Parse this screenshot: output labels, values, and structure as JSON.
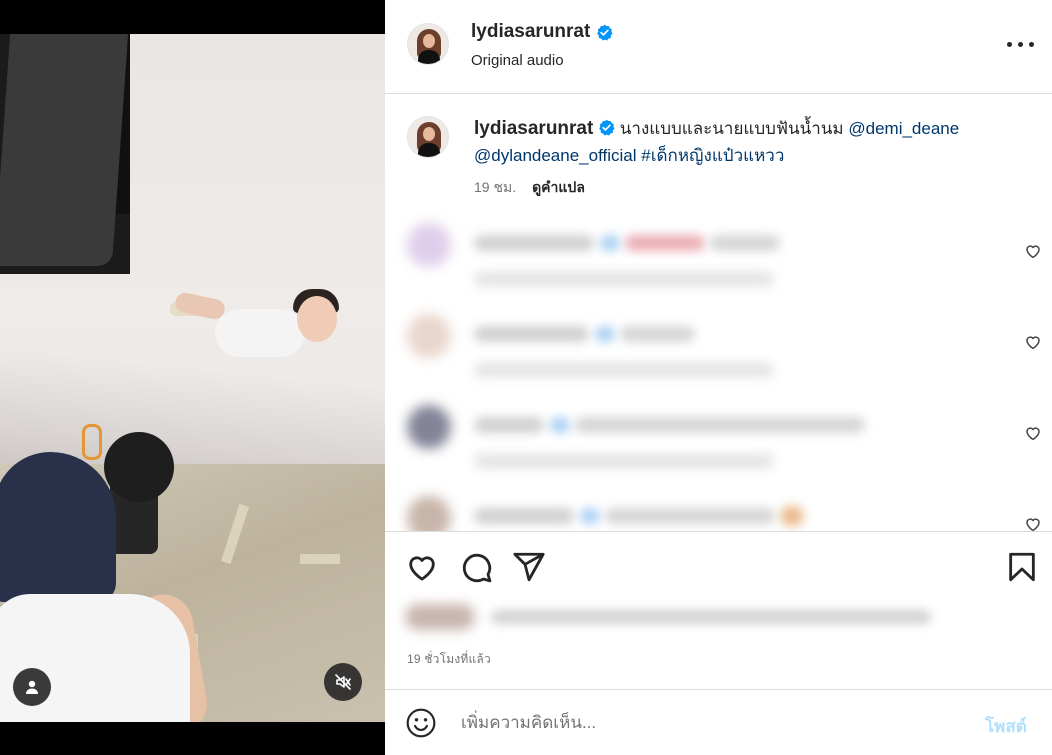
{
  "header": {
    "username": "lydiasarunrat",
    "audio": "Original audio",
    "verified": true
  },
  "caption": {
    "username": "lydiasarunrat",
    "text": "นางแบบและนายแบบฟันน้ำนม",
    "mention1": "@demi_deane",
    "mention2": "@dylandeane_official",
    "hashtag": "#เด็กหญิงแป๋วแหวว",
    "time": "19 ชม.",
    "translate": "ดูคำแปล"
  },
  "actions": {
    "time_ago": "19 ชั่วโมงที่แล้ว"
  },
  "add_comment": {
    "placeholder": "เพิ่มความคิดเห็น...",
    "post_label": "โพสต์"
  },
  "icons": {
    "verified": "verified-badge-icon",
    "more": "more-options-icon",
    "like": "heart-icon",
    "comment": "comment-icon",
    "share": "share-icon",
    "save": "bookmark-icon",
    "emoji": "emoji-icon",
    "user": "user-tag-icon",
    "mute": "muted-speaker-icon"
  },
  "colors": {
    "link": "#00376b",
    "verified": "#0095f6",
    "post_disabled": "#b2dffc"
  }
}
